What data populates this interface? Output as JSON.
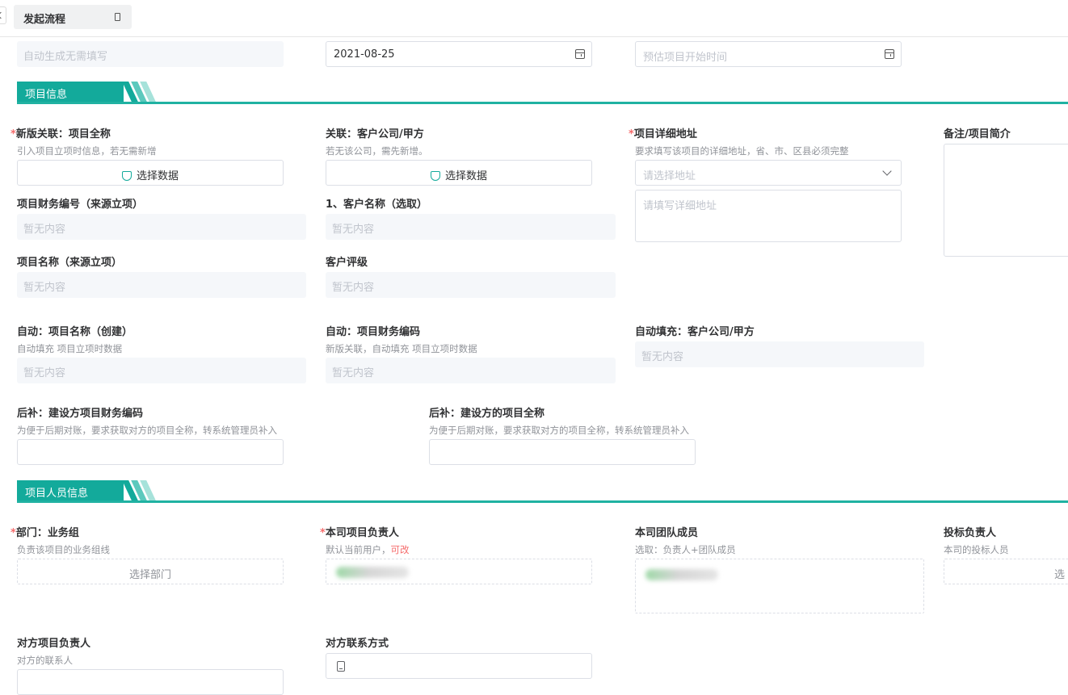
{
  "header": {
    "tab_label": "发起流程"
  },
  "top_row": {
    "auto_field_placeholder": "自动生成无需填写",
    "date_value": "2021-08-25",
    "start_time_placeholder": "预估项目开始时间"
  },
  "sections": {
    "project_info": "项目信息",
    "staff_info": "项目人员信息"
  },
  "project_info": {
    "project_fullname": {
      "label": "新版关联：项目全称",
      "hint": "引入项目立项时信息，若无需新增",
      "button": "选择数据"
    },
    "client_company": {
      "label": "关联：客户公司/甲方",
      "hint": "若无该公司，需先新增。",
      "button": "选择数据"
    },
    "address": {
      "label": "项目详细地址",
      "hint": "要求填写该项目的详细地址，省、市、区县必须完整",
      "select_placeholder": "请选择地址",
      "detail_placeholder": "请填写详细地址"
    },
    "remark": {
      "label": "备注/项目简介"
    },
    "finance_no": {
      "label": "项目财务编号（来源立项）",
      "value": "暂无内容"
    },
    "client_name": {
      "label": "1、客户名称（选取）",
      "value": "暂无内容"
    },
    "project_name": {
      "label": "项目名称（来源立项）",
      "value": "暂无内容"
    },
    "client_rating": {
      "label": "客户评级",
      "value": "暂无内容"
    },
    "auto_project_name": {
      "label": "自动：项目名称（创建）",
      "hint": "自动填充 项目立项时数据",
      "value": "暂无内容"
    },
    "auto_finance_code": {
      "label": "自动：项目财务编码",
      "hint": "新版关联，自动填充 项目立项时数据",
      "value": "暂无内容"
    },
    "auto_client_company": {
      "label": "自动填充：客户公司/甲方",
      "value": "暂无内容"
    },
    "builder_finance_code": {
      "label": "后补：建设方项目财务编码",
      "hint": "为便于后期对账，要求获取对方的项目全称，转系统管理员补入"
    },
    "builder_fullname": {
      "label": "后补：建设方的项目全称",
      "hint": "为便于后期对账，要求获取对方的项目全称，转系统管理员补入"
    }
  },
  "staff_info": {
    "department": {
      "label": "部门：业务组",
      "hint": "负责该项目的业务组线",
      "button": "选择部门"
    },
    "manager": {
      "label": "本司项目负责人",
      "hint": "默认当前用户，",
      "hint_red": "可改"
    },
    "team": {
      "label": "本司团队成员",
      "hint": "选取：负责人+团队成员"
    },
    "bidder": {
      "label": "投标负责人",
      "hint": "本司的投标人员",
      "button": "选"
    },
    "counter_manager": {
      "label": "对方项目负责人",
      "hint": "对方的联系人"
    },
    "counter_contact": {
      "label": "对方联系方式"
    }
  },
  "required_mark": "*",
  "colors": {
    "accent": "#13aa9b",
    "required": "#f56c6c"
  },
  "icons": [
    "calendar-icon",
    "select-data-icon",
    "chevron-down-icon",
    "phone-icon",
    "close-icon",
    "back-icon"
  ]
}
